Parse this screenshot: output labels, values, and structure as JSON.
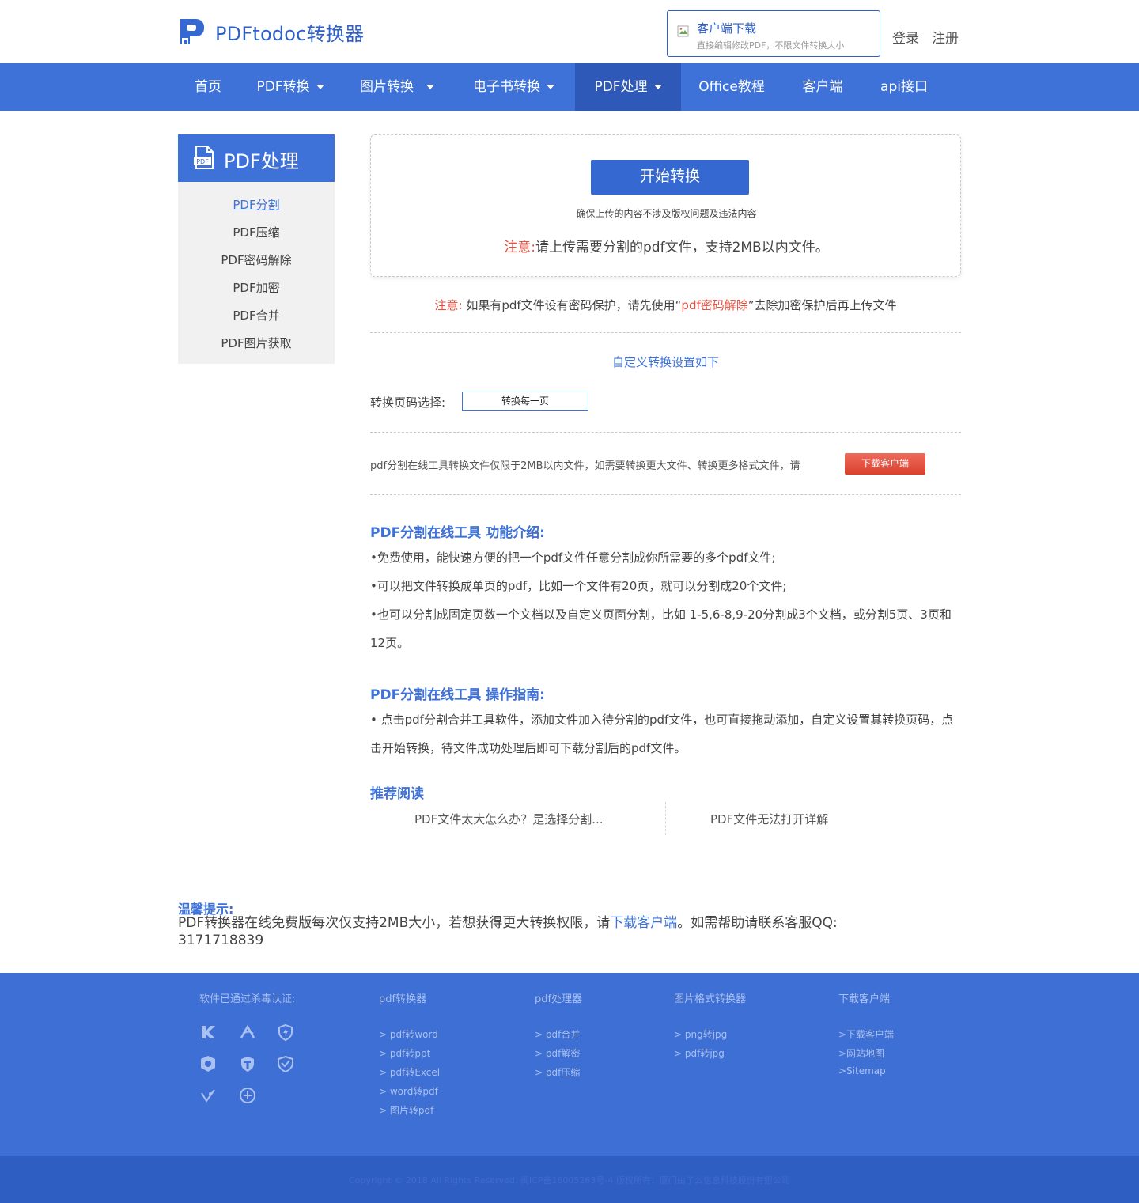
{
  "header": {
    "logo_text": "PDFtodoc转换器",
    "client_download": {
      "title": "客户端下载",
      "subtitle": "直接编辑修改PDF，不限文件转换大小"
    },
    "login": "登录",
    "register": "注册"
  },
  "nav": {
    "items": [
      {
        "label": "首页",
        "dropdown": false
      },
      {
        "label": "PDF转换",
        "dropdown": true
      },
      {
        "label": "图片转换",
        "dropdown": true
      },
      {
        "label": "电子书转换",
        "dropdown": true
      },
      {
        "label": "PDF处理",
        "dropdown": true,
        "active": true
      },
      {
        "label": "Office教程",
        "dropdown": false
      },
      {
        "label": "客户端",
        "dropdown": false
      },
      {
        "label": "api接口",
        "dropdown": false
      }
    ]
  },
  "sidebar": {
    "title": "PDF处理",
    "icon_label": "PDF",
    "items": [
      {
        "label": "PDF分割",
        "active": true
      },
      {
        "label": "PDF压缩"
      },
      {
        "label": "PDF密码解除"
      },
      {
        "label": "PDF加密"
      },
      {
        "label": "PDF合并"
      },
      {
        "label": "PDF图片获取"
      }
    ]
  },
  "upload": {
    "button": "开始转换",
    "note": "确保上传的内容不涉及版权问题及违法内容",
    "warn_prefix": "注意:",
    "warn_text": "请上传需要分割的pdf文件，支持2MB以内文件。"
  },
  "password_note": {
    "prefix": "注意:",
    "text1": "如果有pdf文件设有密码保护，请先使用“",
    "link": "pdf密码解除",
    "text2": "”去除加密保护后再上传文件"
  },
  "settings": {
    "title": "自定义转换设置如下",
    "page_label": "转换页码选择:",
    "page_value": "转换每一页"
  },
  "limit": {
    "text": "pdf分割在线工具转换文件仅限于2MB以内文件，如需要转换更大文件、转换更多格式文件，请",
    "button": "下载客户端"
  },
  "intro": {
    "title": "PDF分割在线工具 功能介绍:",
    "lines": [
      "•免费使用，能快速方便的把一个pdf文件任意分割成你所需要的多个pdf文件;",
      "•可以把文件转换成单页的pdf，比如一个文件有20页，就可以分割成20个文件;",
      "•也可以分割成固定页数一个文档以及自定义页面分割，比如 1-5,6-8,9-20分割成3个文档，或分割5页、3页和12页。"
    ]
  },
  "guide": {
    "title": "PDF分割在线工具 操作指南:",
    "text": "• 点击pdf分割合并工具软件，添加文件加入待分割的pdf文件，也可直接拖动添加，自定义设置其转换页码，点击开始转换，待文件成功处理后即可下载分割后的pdf文件。"
  },
  "recommend": {
    "title": "推荐阅读",
    "items": [
      "PDF文件太大怎么办？是选择分割...",
      "PDF文件无法打开详解"
    ]
  },
  "tip": {
    "title": "温馨提示:",
    "text1": "PDF转换器在线免费版每次仅支持2MB大小，若想获得更大转换权限，请",
    "link": "下载客户端",
    "text2": "。如需帮助请联系客服QQ: 3171718839"
  },
  "footer": {
    "security_title": "软件已通过杀毒认证:",
    "security_icons": [
      "kaspersky-icon",
      "avira-icon",
      "shield-bolt-icon",
      "360-shield-icon",
      "tencent-shield-icon",
      "check-shield-icon",
      "ladybug-icon",
      "plus-circle-icon"
    ],
    "columns": [
      {
        "title": "pdf转换器",
        "links": [
          "> pdf转word",
          "> pdf转ppt",
          "> pdf转Excel",
          "> word转pdf",
          "> 图片转pdf"
        ]
      },
      {
        "title": "pdf处理器",
        "links": [
          "> pdf合并",
          "> pdf解密",
          "> pdf压缩"
        ]
      },
      {
        "title": "图片格式转换器",
        "links": [
          "> png转jpg",
          "> pdf转jpg"
        ]
      },
      {
        "title": "下载客户端",
        "links": [
          ">下载客户端",
          ">网站地图",
          ">Sitemap"
        ]
      }
    ],
    "copyright": "Copyright © 2018 All Rights Reserved. 闽ICP备16005263号-4   版权所有：厦门由了么信息科技股份有限公司"
  },
  "colors": {
    "brand": "#3e72d8",
    "nav_active": "#2e59b9",
    "accent_red": "#e3503e",
    "footer": "#3e6fd4"
  }
}
